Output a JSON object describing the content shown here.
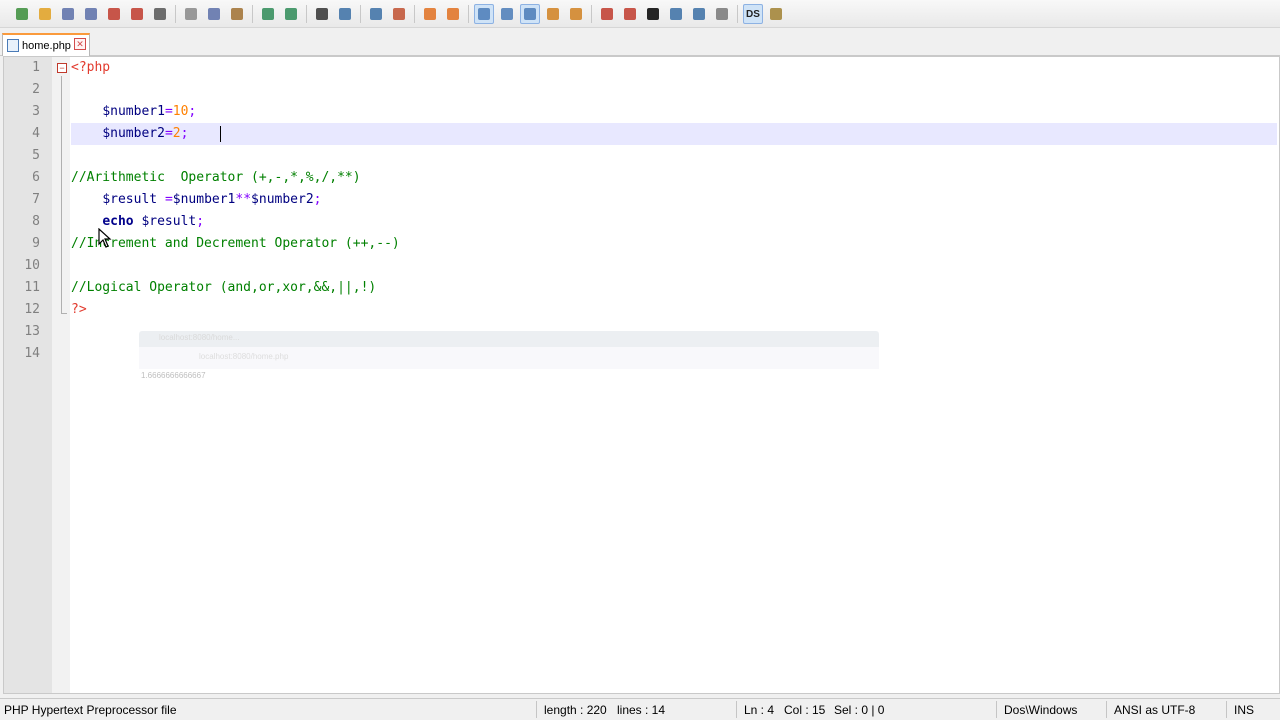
{
  "toolbar": {
    "icons": [
      "new-file",
      "open-file",
      "save",
      "save-all",
      "close",
      "close-all",
      "print",
      "cut",
      "copy",
      "paste",
      "undo",
      "redo",
      "find",
      "replace",
      "zoom-in",
      "zoom-out",
      "sync-vertical",
      "sync-horizontal",
      "word-wrap",
      "show-all-chars",
      "indent-guide",
      "user-defined-lang",
      "doc-map",
      "function-list",
      "record-macro",
      "stop-recording",
      "playback-macro",
      "run-macro-multiple",
      "save-macro",
      "spell-check",
      "ftp"
    ],
    "spell_label": "DS"
  },
  "tab": {
    "label": "home.php",
    "close_glyph": "✕"
  },
  "editor": {
    "line_numbers": [
      "1",
      "2",
      "3",
      "4",
      "5",
      "6",
      "7",
      "8",
      "9",
      "10",
      "11",
      "12",
      "13",
      "14"
    ],
    "fold_glyph": "−",
    "lines": [
      [
        {
          "t": "<?php",
          "c": "php-tag"
        }
      ],
      [],
      [
        {
          "t": "    ",
          "c": "plain"
        },
        {
          "t": "$number1",
          "c": "var"
        },
        {
          "t": "=",
          "c": "op"
        },
        {
          "t": "10",
          "c": "num"
        },
        {
          "t": ";",
          "c": "op"
        }
      ],
      [
        {
          "t": "    ",
          "c": "plain"
        },
        {
          "t": "$number2",
          "c": "var"
        },
        {
          "t": "=",
          "c": "op"
        },
        {
          "t": "2",
          "c": "num"
        },
        {
          "t": ";",
          "c": "op"
        }
      ],
      [],
      [
        {
          "t": "//Arithmetic  Operator (+,-,*,%,/,**)",
          "c": "comment"
        }
      ],
      [
        {
          "t": "    ",
          "c": "plain"
        },
        {
          "t": "$result",
          "c": "var"
        },
        {
          "t": " ",
          "c": "plain"
        },
        {
          "t": "=",
          "c": "op"
        },
        {
          "t": "$number1",
          "c": "var"
        },
        {
          "t": "**",
          "c": "op"
        },
        {
          "t": "$number2",
          "c": "var"
        },
        {
          "t": ";",
          "c": "op"
        }
      ],
      [
        {
          "t": "    ",
          "c": "plain"
        },
        {
          "t": "echo",
          "c": "kw"
        },
        {
          "t": " ",
          "c": "plain"
        },
        {
          "t": "$result",
          "c": "var"
        },
        {
          "t": ";",
          "c": "op"
        }
      ],
      [
        {
          "t": "//Increment and Decrement Operator (++,--)",
          "c": "comment"
        }
      ],
      [],
      [
        {
          "t": "//Logical Operator (and,or,xor,&&,||,!)",
          "c": "comment"
        }
      ],
      [
        {
          "t": "?>",
          "c": "php-tag"
        }
      ],
      [],
      []
    ]
  },
  "ghost_browser": {
    "tab_title": "localhost:8080/home...",
    "url": "localhost:8080/home.php",
    "output": "1.6666666666667"
  },
  "statusbar": {
    "file_type": "PHP Hypertext Preprocessor file",
    "length": "length : 220",
    "lines": "lines : 14",
    "ln": "Ln : 4",
    "col": "Col : 15",
    "sel": "Sel : 0 | 0",
    "eol": "Dos\\Windows",
    "encoding": "ANSI as UTF-8",
    "mode": "INS"
  }
}
